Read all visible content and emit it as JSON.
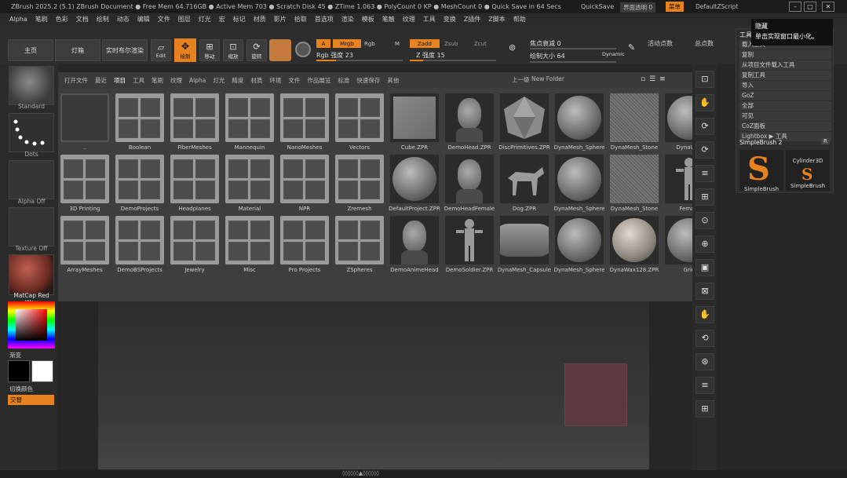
{
  "titlebar": {
    "title": "ZBrush 2025.2 (5.1)  ZBrush Document   ● Free Mem 64.716GB ● Active Mem 703 ● Scratch Disk 45 ● ZTime 1.063 ● PolyCount 0 KP ● MeshCount 0 ● Quick Save in 64 Secs",
    "quicksave": "QuickSave",
    "menus_chip": "界面透明 0",
    "hc_label": "菜单",
    "script_path": "DefaultZScript",
    "win_min": "–",
    "win_max": "□",
    "win_close": "✕"
  },
  "menubar": [
    "Alpha",
    "笔刷",
    "色彩",
    "文档",
    "绘制",
    "动态",
    "编辑",
    "文件",
    "图层",
    "灯光",
    "宏",
    "标记",
    "材质",
    "影片",
    "拾取",
    "首选项",
    "渲染",
    "模板",
    "笔触",
    "纹理",
    "工具",
    "变换",
    "Z插件",
    "Z脚本",
    "帮助"
  ],
  "toolbar": {
    "home": "主页",
    "lightbox": "灯箱",
    "live_boolean": "实时布尔渲染",
    "edit": "Edit",
    "draw": "绘制",
    "move": "移动",
    "scale": "缩放",
    "rotate": "旋转",
    "a_btn": "A",
    "mrgb": "Mrgb",
    "rgb": "Rgb",
    "m": "M",
    "zadd": "Zadd",
    "zsub": "Zsub",
    "zcut": "Zcut",
    "rgb_intensity": "Rgb 强度 23",
    "z_intensity": "Z 强度 15",
    "focal_shift": "焦点衰减 0",
    "draw_size": "绘制大小 64",
    "dynamic": "Dynamic",
    "active_points": "活动点数",
    "total_points": "总点数",
    "rgb_intensity_value": 0.23,
    "z_intensity_value": 0.15
  },
  "leftshelf": {
    "brush": "Standard",
    "stroke": "Dots",
    "alpha": "Alpha Off",
    "texture": "Texture Off",
    "material": "MatCap Red Wax",
    "gradient": "渐变",
    "switch_color": "切换颜色",
    "alternate": "交替"
  },
  "browser": {
    "tabs": [
      "打开文件",
      "最近",
      "项目",
      "工具",
      "笔刷",
      "纹理",
      "Alpha",
      "灯光",
      "精度",
      "材质",
      "环境",
      "文件",
      "作品展览",
      "标准",
      "快速保存",
      "其他"
    ],
    "active_tab": "项目",
    "upfolder": "上一级",
    "new_folder": "New Folder",
    "rows": [
      [
        {
          "label": "..",
          "kind": "folder-empty"
        },
        {
          "label": "Boolean",
          "kind": "folder"
        },
        {
          "label": "FiberMeshes",
          "kind": "folder"
        },
        {
          "label": "Mannequin",
          "kind": "folder"
        },
        {
          "label": "NanoMeshes",
          "kind": "folder"
        },
        {
          "label": "Vectors",
          "kind": "folder"
        },
        {
          "label": "Cube.ZPR",
          "kind": "cube"
        },
        {
          "label": "DemoHead.ZPR",
          "kind": "head"
        },
        {
          "label": "DiscPrimitives.ZPR",
          "kind": "icosa"
        },
        {
          "label": "DynaMesh_Sphere",
          "kind": "sphere"
        },
        {
          "label": "DynaMesh_Stone",
          "kind": "noise"
        },
        {
          "label": "DynaWax",
          "kind": "sphere"
        }
      ],
      [
        {
          "label": "3D Printing",
          "kind": "folder"
        },
        {
          "label": "DemoProjects",
          "kind": "folder"
        },
        {
          "label": "Headplanes",
          "kind": "folder"
        },
        {
          "label": "Material",
          "kind": "folder"
        },
        {
          "label": "NPR",
          "kind": "folder"
        },
        {
          "label": "Zremesh",
          "kind": "folder"
        },
        {
          "label": "DefaultProject.ZPR",
          "kind": "sphere"
        },
        {
          "label": "DemoHeadFemale",
          "kind": "head"
        },
        {
          "label": "Dog.ZPR",
          "kind": "dog"
        },
        {
          "label": "DynaMesh_Sphere",
          "kind": "sphere"
        },
        {
          "label": "DynaMesh_Stone",
          "kind": "noise"
        },
        {
          "label": "Female",
          "kind": "figure"
        }
      ],
      [
        {
          "label": "ArrayMeshes",
          "kind": "folder"
        },
        {
          "label": "DemoBSProjects",
          "kind": "folder"
        },
        {
          "label": "Jewelry",
          "kind": "folder"
        },
        {
          "label": "Misc",
          "kind": "folder"
        },
        {
          "label": "Pro Projects",
          "kind": "folder"
        },
        {
          "label": "ZSpheres",
          "kind": "folder"
        },
        {
          "label": "DemoAnimeHead",
          "kind": "head"
        },
        {
          "label": "DemoSoldier.ZPR",
          "kind": "figure"
        },
        {
          "label": "DynaMesh_Capsule",
          "kind": "capsule"
        },
        {
          "label": "DynaMesh_Sphere",
          "kind": "sphere"
        },
        {
          "label": "DynaWax128.ZPR",
          "kind": "sphere-light"
        },
        {
          "label": "Grid",
          "kind": "sphere"
        }
      ]
    ]
  },
  "rightshelf": [
    "⊡",
    "✋",
    "⟳",
    "⟳",
    "≡",
    "⊞",
    "⊙",
    "⊕",
    "▣",
    "⊠",
    "✋",
    "⟲",
    "⊛",
    "≡",
    "⊞"
  ],
  "panel": {
    "title": "工具",
    "rows": [
      "载入工具",
      "复制",
      "从项目文件载入工具",
      "复制工具",
      "导入",
      "GoZ",
      "全部",
      "可见",
      "CoZ面板",
      "Lightbox ▶ 工具"
    ],
    "tool_name": "SimpleBrush 2",
    "r": "R",
    "tool1": "SimpleBrush",
    "tool2": "SimpleBrush",
    "tool2_top": "Cylinder3D"
  },
  "tooltip": {
    "line1": "隐藏",
    "line2": "单击实现窗口最小化。"
  },
  "bottombar": "◊◊◊◊◊◊▲◊◊◊◊◊◊"
}
